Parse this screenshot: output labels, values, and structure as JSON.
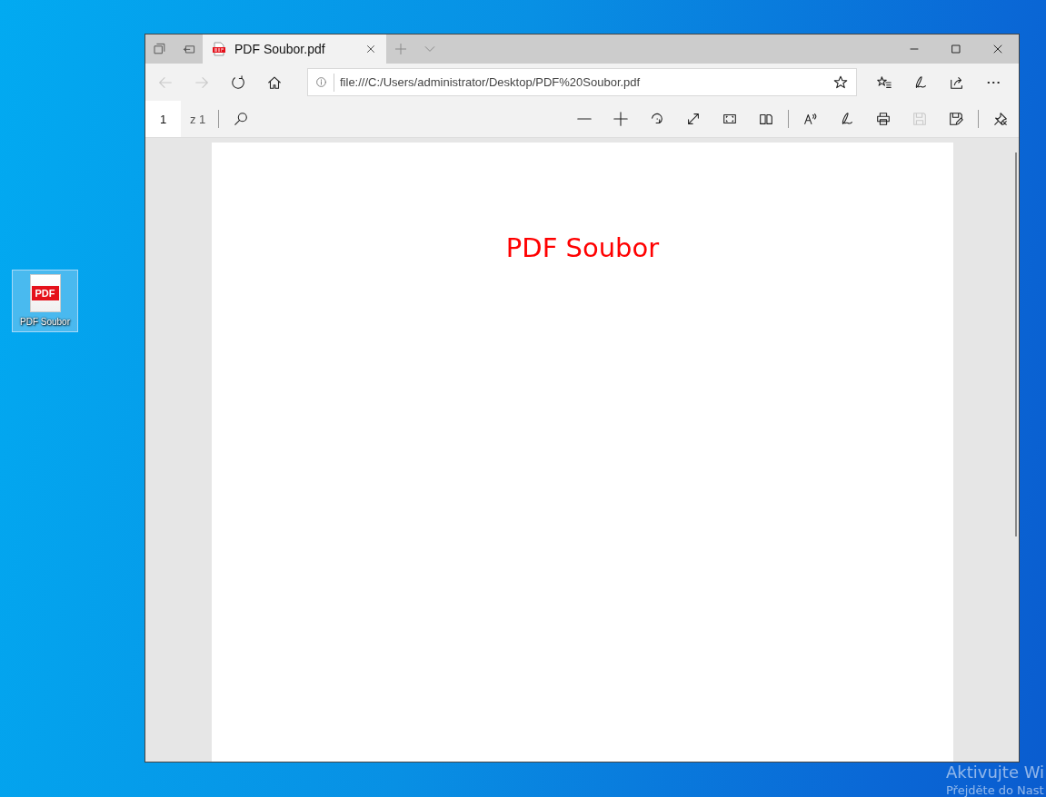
{
  "desktop": {
    "icons": [
      {
        "label": "PDF Soubor",
        "badge": "PDF",
        "selected": true
      }
    ],
    "activation_notice": {
      "title": "Aktivujte Wi",
      "subtitle": "Přejděte do Nast"
    }
  },
  "window": {
    "tab_actions": [
      {
        "kind": "tabs-aside"
      },
      {
        "kind": "set-aside"
      }
    ],
    "tabs": [
      {
        "title": "PDF Soubor.pdf",
        "selected": true
      }
    ],
    "tab_bar_buttons": [
      {
        "kind": "new-tab"
      },
      {
        "kind": "dropdown"
      }
    ],
    "window_controls": [
      {
        "kind": "minimize"
      },
      {
        "kind": "maximize"
      },
      {
        "kind": "close"
      }
    ],
    "nav": [
      {
        "kind": "back",
        "disabled": true
      },
      {
        "kind": "forward",
        "disabled": true
      },
      {
        "kind": "refresh",
        "disabled": false
      },
      {
        "kind": "home",
        "disabled": false
      }
    ],
    "address": {
      "value": "file:///C:/Users/administrator/Desktop/PDF%20Soubor.pdf"
    },
    "browser_tools": [
      {
        "kind": "favorites",
        "disabled": false
      },
      {
        "kind": "ink",
        "disabled": false
      },
      {
        "kind": "share",
        "disabled": false
      },
      {
        "kind": "more",
        "disabled": false
      }
    ],
    "pdf_toolbar": {
      "page": "1",
      "page_count": "z 1",
      "tools": [
        {
          "kind": "zoom-out",
          "disabled": false
        },
        {
          "kind": "zoom-in",
          "disabled": false
        },
        {
          "kind": "rotate",
          "disabled": false
        },
        {
          "kind": "fit",
          "disabled": false
        },
        {
          "kind": "fullscreen",
          "disabled": false
        },
        {
          "kind": "page-view",
          "disabled": false
        },
        {
          "kind": "separator"
        },
        {
          "kind": "read-aloud",
          "disabled": false
        },
        {
          "kind": "draw",
          "disabled": false
        },
        {
          "kind": "print",
          "disabled": false
        },
        {
          "kind": "save",
          "disabled": true
        },
        {
          "kind": "save-as",
          "disabled": false
        },
        {
          "kind": "separator"
        },
        {
          "kind": "pin",
          "disabled": false
        }
      ]
    },
    "document": {
      "heading": "PDF Soubor"
    }
  }
}
